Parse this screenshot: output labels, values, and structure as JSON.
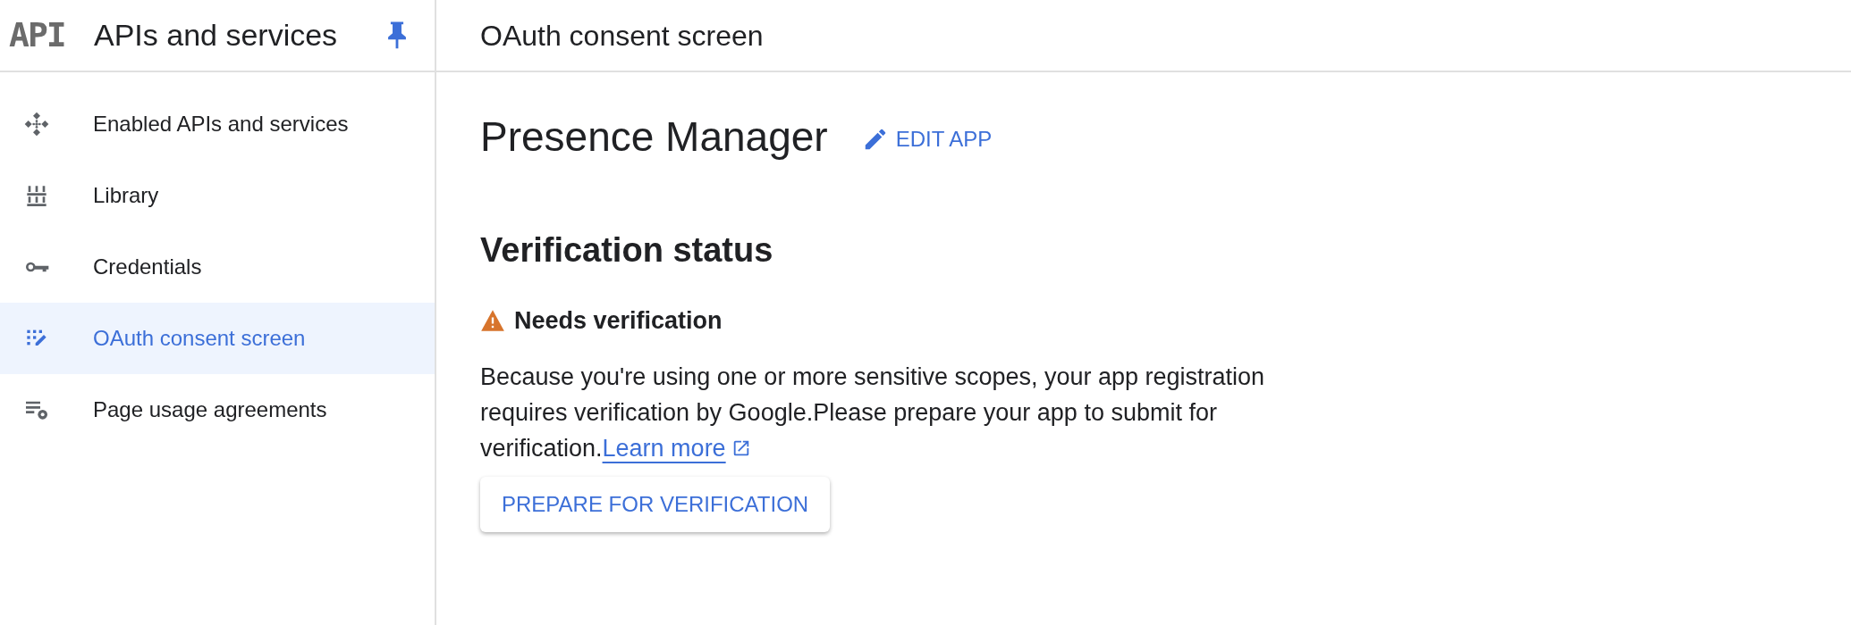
{
  "sidebar": {
    "logo": "API",
    "title": "APIs and services",
    "pinned": true,
    "items": [
      {
        "label": "Enabled APIs and services",
        "selected": false
      },
      {
        "label": "Library",
        "selected": false
      },
      {
        "label": "Credentials",
        "selected": false
      },
      {
        "label": "OAuth consent screen",
        "selected": true
      },
      {
        "label": "Page usage agreements",
        "selected": false
      }
    ]
  },
  "header": {
    "title": "OAuth consent screen"
  },
  "app": {
    "name": "Presence Manager",
    "edit_button": "EDIT APP"
  },
  "verification": {
    "heading": "Verification status",
    "status": "Needs verification",
    "body": "Because you're using one or more sensitive scopes, your app registration requires verification by Google.Please prepare your app to submit for verification.",
    "link": "Learn more",
    "button": "PREPARE FOR VERIFICATION"
  }
}
